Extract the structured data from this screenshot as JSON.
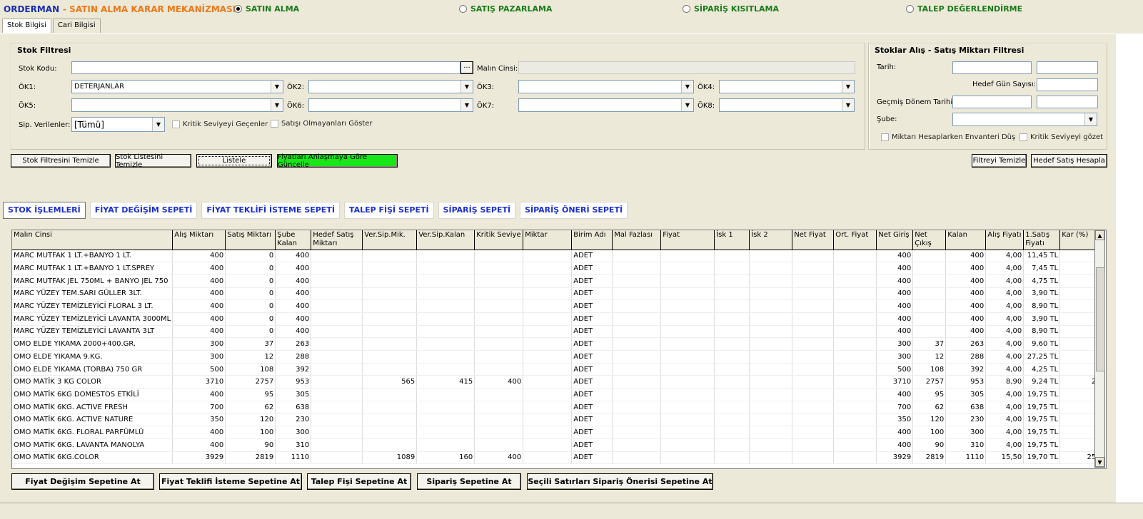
{
  "app": {
    "title_prefix": "ORDERMAN",
    "title_sep": " - ",
    "title_main": "SATIN ALMA KARAR MEKANİZMASI"
  },
  "modes": [
    {
      "label": "SATIN ALMA",
      "selected": true
    },
    {
      "label": "SATIŞ PAZARLAMA",
      "selected": false
    },
    {
      "label": "SİPARİŞ KISITLAMA",
      "selected": false
    },
    {
      "label": "TALEP DEĞERLENDİRME",
      "selected": false
    }
  ],
  "top_tabs": [
    "Stok Bilgisi",
    "Cari Bilgisi"
  ],
  "stok_filtresi": {
    "title": "Stok Filtresi",
    "stok_kodu_label": "Stok Kodu:",
    "malin_cinsi_label": "Malın Cinsi:",
    "browse": "···",
    "ok_labels": [
      "ÖK1:",
      "ÖK2:",
      "ÖK3:",
      "ÖK4:",
      "ÖK5:",
      "ÖK6:",
      "ÖK7:",
      "ÖK8:"
    ],
    "ok1_value": "DETERJANLAR",
    "sip_label": "Sip. Verilenler:",
    "sip_value": "[Tümü]",
    "kritik_label": "Kritik Seviyeyi Geçenler",
    "satisi_label": "Satışı Olmayanları Göster"
  },
  "miktar_filtresi": {
    "title": "Stoklar Alış - Satış Miktarı Filtresi",
    "tarih": "Tarih:",
    "hedef": "Hedef Gün Sayısı:",
    "gecmis": "Geçmiş Dönem Tarihi:",
    "sube": "Şube:",
    "envanter": "Miktarı Hesaplarken Envanteri Düş",
    "kritik_gozet": "Kritik Seviyeyi gözet"
  },
  "buttons": {
    "stok_filtresini_temizle": "Stok Filtresini Temizle",
    "stok_listesini_temizle": "Stok Listesini Temizle",
    "listele": "Listele",
    "fiyatlari": "Fiyatları Anlaşmaya Göre Güncelle",
    "filtreyi_temizle": "Filtreyi Temizle",
    "hedef_satis": "Hedef Satış Hesapla"
  },
  "sepet_tabs": [
    "STOK İŞLEMLERİ",
    "FİYAT DEĞİŞİM SEPETİ",
    "FİYAT TEKLİFİ İSTEME SEPETİ",
    "TALEP FİŞİ SEPETİ",
    "SİPARİŞ SEPETİ",
    "SİPARİŞ ÖNERİ SEPETİ"
  ],
  "grid": {
    "columns": [
      "Malın Cinsi",
      "Alış Miktarı",
      "Satış Miktarı",
      "Şube Kalan",
      "Hedef Satış Miktarı",
      "Ver.Sip.Mik.",
      "Ver.Sip.Kalan",
      "Kritik Seviye",
      "Miktar",
      "Birim Adı",
      "Mal Fazlası",
      "Fiyat",
      "İsk 1",
      "İsk 2",
      "Net Fiyat",
      "Ort. Fiyat",
      "Net Giriş",
      "Net Çıkış",
      "Kalan",
      "Alış Fiyatı",
      "1.Satış Fiyatı",
      "Kar (%)"
    ],
    "rows": [
      [
        "MARC MUTFAK 1 LT.+BANYO 1 LT.",
        "400",
        "0",
        "400",
        "",
        "",
        "",
        "",
        "",
        "ADET",
        "",
        "",
        "",
        "",
        "",
        "",
        "400",
        "",
        "400",
        "4,00",
        "11,45 TL",
        ""
      ],
      [
        "MARC MUTFAK 1 LT.+BANYO 1 LT.SPREY",
        "400",
        "0",
        "400",
        "",
        "",
        "",
        "",
        "",
        "ADET",
        "",
        "",
        "",
        "",
        "",
        "",
        "400",
        "",
        "400",
        "4,00",
        "7,45 TL",
        ""
      ],
      [
        "MARC MUTFAK JEL 750ML + BANYO JEL 750",
        "400",
        "0",
        "400",
        "",
        "",
        "",
        "",
        "",
        "ADET",
        "",
        "",
        "",
        "",
        "",
        "",
        "400",
        "",
        "400",
        "4,00",
        "4,75 TL",
        ""
      ],
      [
        "MARC YÜZEY TEM.SARI GÜLLER 3LT.",
        "400",
        "0",
        "400",
        "",
        "",
        "",
        "",
        "",
        "ADET",
        "",
        "",
        "",
        "",
        "",
        "",
        "400",
        "",
        "400",
        "4,00",
        "3,90 TL",
        ""
      ],
      [
        "MARC YÜZEY TEMİZLEYİCİ FLORAL 3 LT.",
        "400",
        "0",
        "400",
        "",
        "",
        "",
        "",
        "",
        "ADET",
        "",
        "",
        "",
        "",
        "",
        "",
        "400",
        "",
        "400",
        "4,00",
        "8,90 TL",
        ""
      ],
      [
        "MARC YÜZEY TEMİZLEYİCİ LAVANTA 3000ML",
        "400",
        "0",
        "400",
        "",
        "",
        "",
        "",
        "",
        "ADET",
        "",
        "",
        "",
        "",
        "",
        "",
        "400",
        "",
        "400",
        "4,00",
        "3,90 TL",
        ""
      ],
      [
        "MARC YÜZEY TEMİZLEYİCİ LAVANTA 3LT",
        "400",
        "0",
        "400",
        "",
        "",
        "",
        "",
        "",
        "ADET",
        "",
        "",
        "",
        "",
        "",
        "",
        "400",
        "",
        "400",
        "4,00",
        "8,90 TL",
        ""
      ],
      [
        "OMO  ELDE YIKAMA 2000+400.GR.",
        "300",
        "37",
        "263",
        "",
        "",
        "",
        "",
        "",
        "ADET",
        "",
        "",
        "",
        "",
        "",
        "",
        "300",
        "37",
        "263",
        "4,00",
        "9,60 TL",
        ""
      ],
      [
        "OMO  ELDE YIKAMA 9.KG.",
        "300",
        "12",
        "288",
        "",
        "",
        "",
        "",
        "",
        "ADET",
        "",
        "",
        "",
        "",
        "",
        "",
        "300",
        "12",
        "288",
        "4,00",
        "27,25 TL",
        ""
      ],
      [
        "OMO ELDE YIKAMA (TORBA) 750 GR",
        "500",
        "108",
        "392",
        "",
        "",
        "",
        "",
        "",
        "ADET",
        "",
        "",
        "",
        "",
        "",
        "",
        "500",
        "108",
        "392",
        "4,00",
        "4,25 TL",
        ""
      ],
      [
        "OMO MATİK 3 KG COLOR",
        "3710",
        "2757",
        "953",
        "",
        "565",
        "415",
        "400",
        "",
        "ADET",
        "",
        "",
        "",
        "",
        "",
        "",
        "3710",
        "2757",
        "953",
        "8,90",
        "9,24 TL",
        "2"
      ],
      [
        "OMO MATİK 6KG  DOMESTOS ETKİLİ",
        "400",
        "95",
        "305",
        "",
        "",
        "",
        "",
        "",
        "ADET",
        "",
        "",
        "",
        "",
        "",
        "",
        "400",
        "95",
        "305",
        "4,00",
        "19,75 TL",
        ""
      ],
      [
        "OMO MATİK 6KG. ACTIVE FRESH",
        "700",
        "62",
        "638",
        "",
        "",
        "",
        "",
        "",
        "ADET",
        "",
        "",
        "",
        "",
        "",
        "",
        "700",
        "62",
        "638",
        "4,00",
        "19,75 TL",
        ""
      ],
      [
        "OMO MATİK 6KG. ACTIVE NATURE",
        "350",
        "120",
        "230",
        "",
        "",
        "",
        "",
        "",
        "ADET",
        "",
        "",
        "",
        "",
        "",
        "",
        "350",
        "120",
        "230",
        "4,00",
        "19,75 TL",
        ""
      ],
      [
        "OMO MATİK 6KG. FLORAL PARFÜMLÜ",
        "400",
        "100",
        "300",
        "",
        "",
        "",
        "",
        "",
        "ADET",
        "",
        "",
        "",
        "",
        "",
        "",
        "400",
        "100",
        "300",
        "4,00",
        "19,75 TL",
        ""
      ],
      [
        "OMO MATİK 6KG. LAVANTA MANOLYA",
        "400",
        "90",
        "310",
        "",
        "",
        "",
        "",
        "",
        "ADET",
        "",
        "",
        "",
        "",
        "",
        "",
        "400",
        "90",
        "310",
        "4,00",
        "19,75 TL",
        ""
      ],
      [
        "OMO MATİK 6KG.COLOR",
        "3929",
        "2819",
        "1110",
        "",
        "1089",
        "160",
        "400",
        "",
        "ADET",
        "",
        "",
        "",
        "",
        "",
        "",
        "3929",
        "2819",
        "1110",
        "15,50",
        "19,70 TL",
        "25"
      ]
    ]
  },
  "bottom_buttons": [
    "Fiyat Değişim Sepetine At",
    "Fiyat Teklifi İsteme Sepetine At",
    "Talep Fişi Sepetine At",
    "Sipariş Sepetine At",
    "Seçili Satırları Sipariş Önerisi Sepetine At"
  ]
}
